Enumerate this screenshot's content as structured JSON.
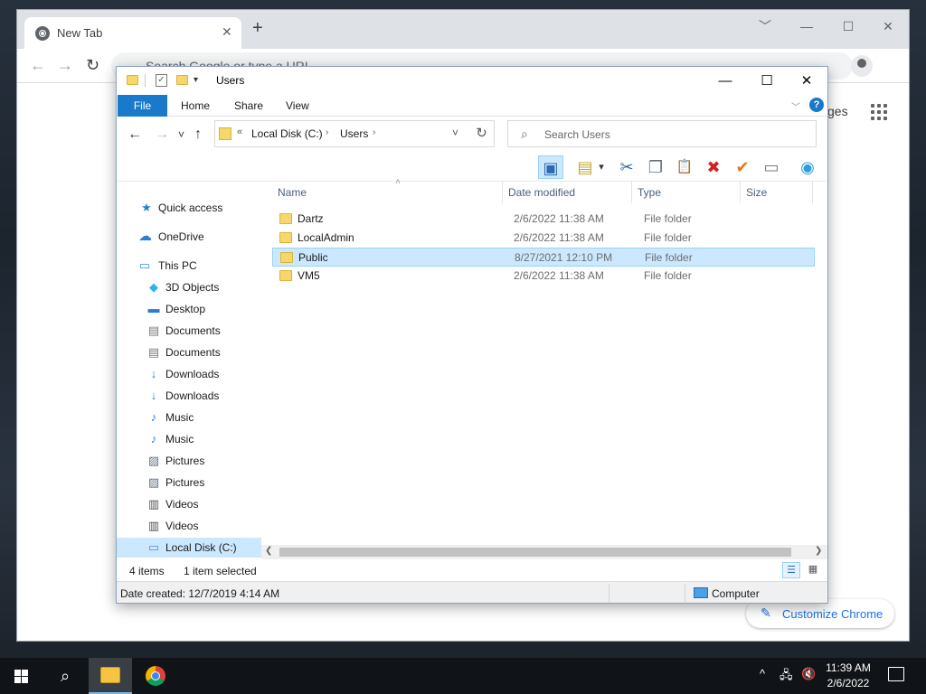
{
  "chrome": {
    "tab_title": "New Tab",
    "tab_close": "✕",
    "new_tab": "+",
    "minimize": "﹀",
    "min2": "—",
    "maximize": "☐",
    "close": "✕",
    "back": "←",
    "forward": "→",
    "reload": "↻",
    "omnibox_placeholder": "Search Google or type a URL",
    "images_link": "ges",
    "customize_label": "Customize Chrome",
    "customize_icon": "✎"
  },
  "explorer": {
    "title": "Users",
    "qat_check": "✓",
    "qat_dropdown": "▾",
    "win_min": "—",
    "win_max": "☐",
    "win_close": "✕",
    "ribbon": {
      "file": "File",
      "home": "Home",
      "share": "Share",
      "view": "View",
      "expand": "﹀",
      "help": "?"
    },
    "nav": {
      "back": "←",
      "forward": "→",
      "recent": "˅",
      "up": "↑",
      "refresh": "↻"
    },
    "address": {
      "chevron": "«",
      "crumbs": [
        "Local Disk (C:)",
        "Users"
      ],
      "sep": "›",
      "dropdown": "˅"
    },
    "search_placeholder": "Search Users",
    "search_icon": "⌕",
    "toolbar": {
      "preview_pane": "▣",
      "new_folder": "▤",
      "dropdown": "▾",
      "cut": "✂",
      "copy": "❐",
      "paste": "📋",
      "delete": "✖",
      "properties": "✔",
      "rename": "▭",
      "network": "◉"
    },
    "sidebar": [
      {
        "label": "Quick access",
        "icon": "★",
        "color": "#2a7fd4"
      },
      {
        "label": "OneDrive",
        "icon": "☁",
        "color": "#2a7fd4"
      },
      {
        "label": "This PC",
        "icon": "▭",
        "color": "#3a8de0"
      },
      {
        "label": "3D Objects",
        "icon": "◆",
        "color": "#2cb5e8"
      },
      {
        "label": "Desktop",
        "icon": "▬",
        "color": "#2a7fd4"
      },
      {
        "label": "Documents",
        "icon": "▤",
        "color": "#777777"
      },
      {
        "label": "Documents",
        "icon": "▤",
        "color": "#777777"
      },
      {
        "label": "Downloads",
        "icon": "↓",
        "color": "#2a7fd4"
      },
      {
        "label": "Downloads",
        "icon": "↓",
        "color": "#2a7fd4"
      },
      {
        "label": "Music",
        "icon": "♪",
        "color": "#2a7fd4"
      },
      {
        "label": "Music",
        "icon": "♪",
        "color": "#2a7fd4"
      },
      {
        "label": "Pictures",
        "icon": "▨",
        "color": "#607080"
      },
      {
        "label": "Pictures",
        "icon": "▨",
        "color": "#607080"
      },
      {
        "label": "Videos",
        "icon": "▥",
        "color": "#505050"
      },
      {
        "label": "Videos",
        "icon": "▥",
        "color": "#505050"
      },
      {
        "label": "Local Disk (C:)",
        "icon": "▭",
        "color": "#4b8fd6"
      }
    ],
    "columns": [
      "Name",
      "Date modified",
      "Type",
      "Size"
    ],
    "sort_arrow": "˄",
    "rows": [
      {
        "name": "Dartz",
        "date": "2/6/2022 11:38 AM",
        "type": "File folder"
      },
      {
        "name": "LocalAdmin",
        "date": "2/6/2022 11:38 AM",
        "type": "File folder"
      },
      {
        "name": "Public",
        "date": "8/27/2021 12:10 PM",
        "type": "File folder"
      },
      {
        "name": "VM5",
        "date": "2/6/2022 11:38 AM",
        "type": "File folder"
      }
    ],
    "scroll_left": "❮",
    "scroll_right": "❯",
    "status": {
      "items": "4 items",
      "selected": "1 item selected",
      "view_details": "☰",
      "view_tiles": "▦"
    },
    "details": {
      "text": "Date created: 12/7/2019 4:14 AM",
      "computer": "Computer"
    }
  },
  "taskbar": {
    "search_icon": "⌕",
    "tray_up": "^",
    "tray_network": "🖧",
    "tray_volume": "🔇",
    "time": "11:39 AM",
    "date": "2/6/2022"
  }
}
